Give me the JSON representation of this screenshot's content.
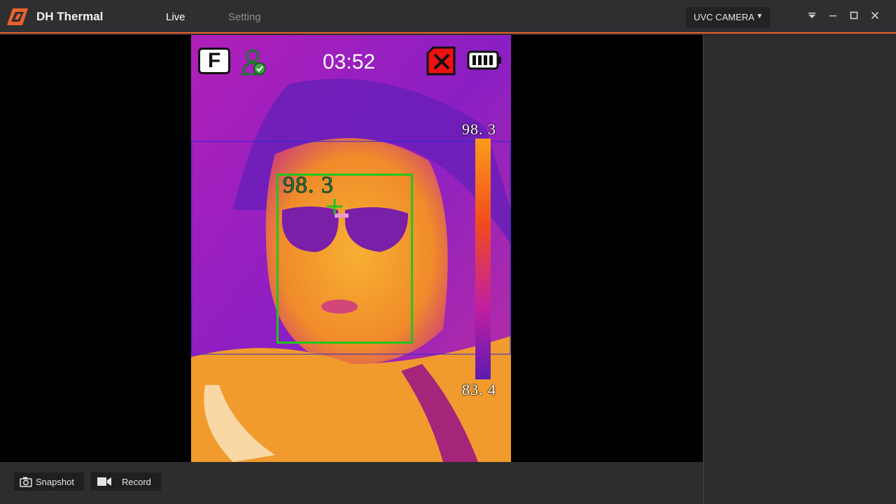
{
  "app": {
    "title": "DH Thermal",
    "accent_color": "#e8632b",
    "logo_icon": "dh-logo-icon"
  },
  "tabs": [
    {
      "label": "Live",
      "active": true
    },
    {
      "label": "Setting",
      "active": false
    }
  ],
  "camera_select": {
    "value": "UVC CAMERA",
    "caret_icon": "caret-down-icon"
  },
  "window_controls": [
    {
      "name": "dropdown-menu-icon",
      "glyph": "⏷"
    },
    {
      "name": "minimize-icon",
      "glyph": "—"
    },
    {
      "name": "maximize-icon",
      "glyph": "☐"
    },
    {
      "name": "close-icon",
      "glyph": "✕"
    }
  ],
  "feed": {
    "clock": "03:52",
    "unit_label": "F",
    "scale_max": "98. 3",
    "scale_min": "83. 4",
    "face_temperature": "98. 3",
    "icons": [
      "fahrenheit-icon",
      "person-verified-icon",
      "sd-card-error-icon",
      "battery-full-icon",
      "crosshair-icon"
    ],
    "box_color": "#22c51e"
  },
  "actions": {
    "snapshot_label": "Snapshot",
    "record_label": "Record"
  }
}
